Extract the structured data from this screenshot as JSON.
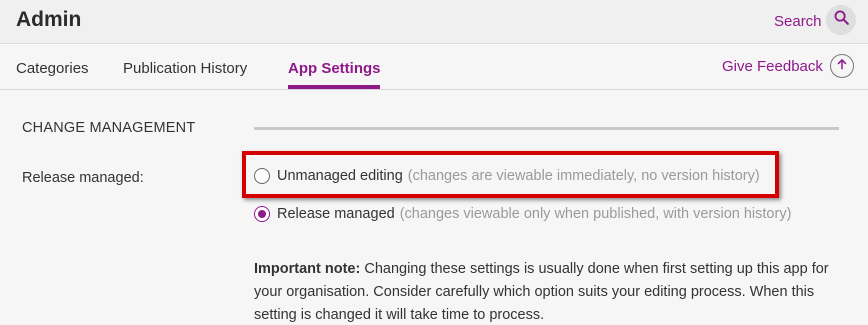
{
  "header": {
    "title": "Admin",
    "search_label": "Search",
    "search_icon": "search-icon"
  },
  "tabs": [
    {
      "label": "Categories",
      "active": false
    },
    {
      "label": "Publication History",
      "active": false
    },
    {
      "label": "App Settings",
      "active": true
    }
  ],
  "feedback": {
    "label": "Give Feedback",
    "icon": "arrow-up-circle-icon"
  },
  "section": {
    "title": "CHANGE MANAGEMENT"
  },
  "release_setting": {
    "label": "Release managed:",
    "options": [
      {
        "label": "Unmanaged editing",
        "description": "(changes are viewable immediately, no version history)",
        "selected": false
      },
      {
        "label": "Release managed",
        "description": "(changes viewable only when published, with version history)",
        "selected": true
      }
    ]
  },
  "note": {
    "bold": "Important note:",
    "text": "Changing these settings is usually done when first setting up this app for your organisation. Consider carefully which option suits your editing process. When this setting is changed it will take time to process."
  },
  "colors": {
    "accent": "#8e1a8a",
    "highlight": "#d40000"
  }
}
